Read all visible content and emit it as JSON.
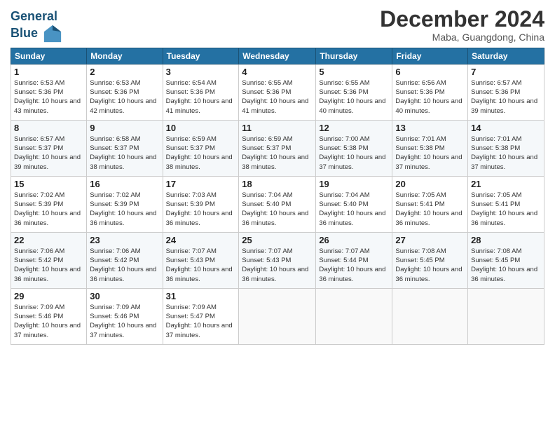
{
  "header": {
    "logo_line1": "General",
    "logo_line2": "Blue",
    "month": "December 2024",
    "location": "Maba, Guangdong, China"
  },
  "weekdays": [
    "Sunday",
    "Monday",
    "Tuesday",
    "Wednesday",
    "Thursday",
    "Friday",
    "Saturday"
  ],
  "weeks": [
    [
      {
        "day": "1",
        "sunrise": "6:53 AM",
        "sunset": "5:36 PM",
        "daylight": "10 hours and 43 minutes."
      },
      {
        "day": "2",
        "sunrise": "6:53 AM",
        "sunset": "5:36 PM",
        "daylight": "10 hours and 42 minutes."
      },
      {
        "day": "3",
        "sunrise": "6:54 AM",
        "sunset": "5:36 PM",
        "daylight": "10 hours and 41 minutes."
      },
      {
        "day": "4",
        "sunrise": "6:55 AM",
        "sunset": "5:36 PM",
        "daylight": "10 hours and 41 minutes."
      },
      {
        "day": "5",
        "sunrise": "6:55 AM",
        "sunset": "5:36 PM",
        "daylight": "10 hours and 40 minutes."
      },
      {
        "day": "6",
        "sunrise": "6:56 AM",
        "sunset": "5:36 PM",
        "daylight": "10 hours and 40 minutes."
      },
      {
        "day": "7",
        "sunrise": "6:57 AM",
        "sunset": "5:36 PM",
        "daylight": "10 hours and 39 minutes."
      }
    ],
    [
      {
        "day": "8",
        "sunrise": "6:57 AM",
        "sunset": "5:37 PM",
        "daylight": "10 hours and 39 minutes."
      },
      {
        "day": "9",
        "sunrise": "6:58 AM",
        "sunset": "5:37 PM",
        "daylight": "10 hours and 38 minutes."
      },
      {
        "day": "10",
        "sunrise": "6:59 AM",
        "sunset": "5:37 PM",
        "daylight": "10 hours and 38 minutes."
      },
      {
        "day": "11",
        "sunrise": "6:59 AM",
        "sunset": "5:37 PM",
        "daylight": "10 hours and 38 minutes."
      },
      {
        "day": "12",
        "sunrise": "7:00 AM",
        "sunset": "5:38 PM",
        "daylight": "10 hours and 37 minutes."
      },
      {
        "day": "13",
        "sunrise": "7:01 AM",
        "sunset": "5:38 PM",
        "daylight": "10 hours and 37 minutes."
      },
      {
        "day": "14",
        "sunrise": "7:01 AM",
        "sunset": "5:38 PM",
        "daylight": "10 hours and 37 minutes."
      }
    ],
    [
      {
        "day": "15",
        "sunrise": "7:02 AM",
        "sunset": "5:39 PM",
        "daylight": "10 hours and 36 minutes."
      },
      {
        "day": "16",
        "sunrise": "7:02 AM",
        "sunset": "5:39 PM",
        "daylight": "10 hours and 36 minutes."
      },
      {
        "day": "17",
        "sunrise": "7:03 AM",
        "sunset": "5:39 PM",
        "daylight": "10 hours and 36 minutes."
      },
      {
        "day": "18",
        "sunrise": "7:04 AM",
        "sunset": "5:40 PM",
        "daylight": "10 hours and 36 minutes."
      },
      {
        "day": "19",
        "sunrise": "7:04 AM",
        "sunset": "5:40 PM",
        "daylight": "10 hours and 36 minutes."
      },
      {
        "day": "20",
        "sunrise": "7:05 AM",
        "sunset": "5:41 PM",
        "daylight": "10 hours and 36 minutes."
      },
      {
        "day": "21",
        "sunrise": "7:05 AM",
        "sunset": "5:41 PM",
        "daylight": "10 hours and 36 minutes."
      }
    ],
    [
      {
        "day": "22",
        "sunrise": "7:06 AM",
        "sunset": "5:42 PM",
        "daylight": "10 hours and 36 minutes."
      },
      {
        "day": "23",
        "sunrise": "7:06 AM",
        "sunset": "5:42 PM",
        "daylight": "10 hours and 36 minutes."
      },
      {
        "day": "24",
        "sunrise": "7:07 AM",
        "sunset": "5:43 PM",
        "daylight": "10 hours and 36 minutes."
      },
      {
        "day": "25",
        "sunrise": "7:07 AM",
        "sunset": "5:43 PM",
        "daylight": "10 hours and 36 minutes."
      },
      {
        "day": "26",
        "sunrise": "7:07 AM",
        "sunset": "5:44 PM",
        "daylight": "10 hours and 36 minutes."
      },
      {
        "day": "27",
        "sunrise": "7:08 AM",
        "sunset": "5:45 PM",
        "daylight": "10 hours and 36 minutes."
      },
      {
        "day": "28",
        "sunrise": "7:08 AM",
        "sunset": "5:45 PM",
        "daylight": "10 hours and 36 minutes."
      }
    ],
    [
      {
        "day": "29",
        "sunrise": "7:09 AM",
        "sunset": "5:46 PM",
        "daylight": "10 hours and 37 minutes."
      },
      {
        "day": "30",
        "sunrise": "7:09 AM",
        "sunset": "5:46 PM",
        "daylight": "10 hours and 37 minutes."
      },
      {
        "day": "31",
        "sunrise": "7:09 AM",
        "sunset": "5:47 PM",
        "daylight": "10 hours and 37 minutes."
      },
      null,
      null,
      null,
      null
    ]
  ]
}
